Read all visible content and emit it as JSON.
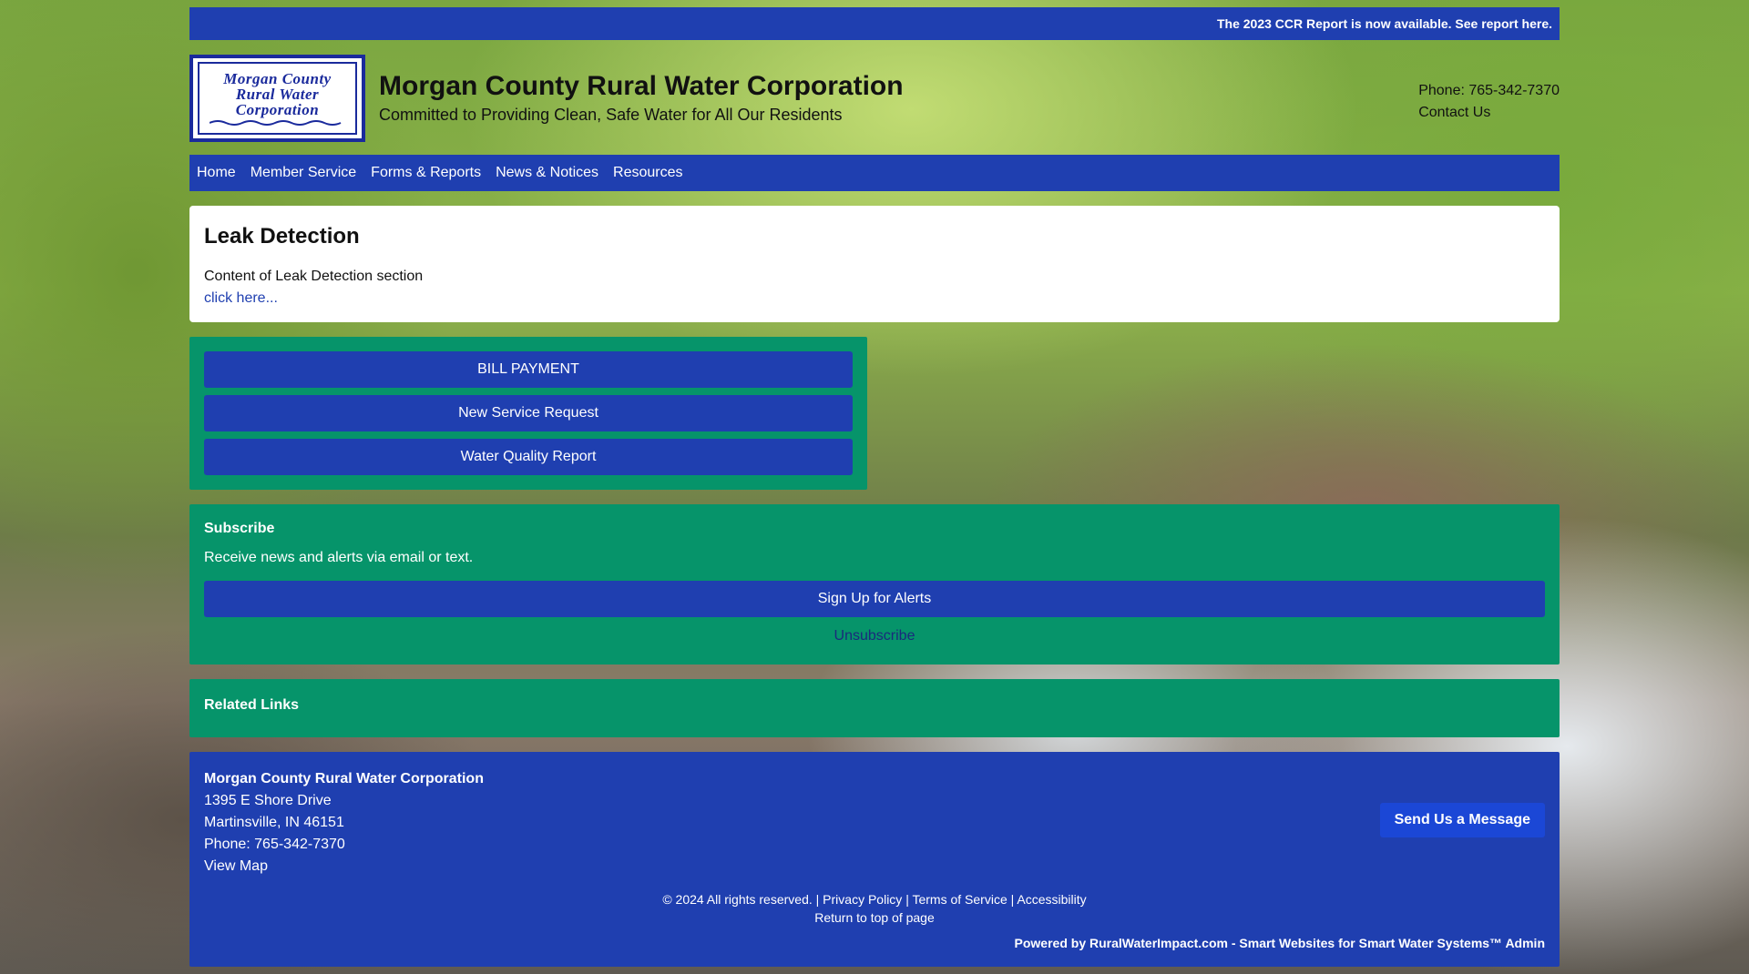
{
  "announcement": "The 2023 CCR Report is now available. See report here.",
  "logo": {
    "line1": "Morgan County",
    "line2": "Rural Water",
    "line3": "Corporation"
  },
  "header": {
    "title": "Morgan County Rural Water Corporation",
    "tagline": "Committed to Providing Clean, Safe Water for All Our Residents",
    "phone": "Phone: 765-342-7370",
    "contact": "Contact Us"
  },
  "nav": {
    "items": [
      "Home",
      "Member Service",
      "Forms & Reports",
      "News & Notices",
      "Resources"
    ]
  },
  "section": {
    "title": "Leak Detection",
    "content": "Content of Leak Detection section",
    "link": "click here..."
  },
  "quick_links": {
    "bill_payment": "BILL PAYMENT",
    "new_service": "New Service Request",
    "water_quality": "Water Quality Report"
  },
  "subscribe": {
    "title": "Subscribe",
    "text": "Receive news and alerts via email or text.",
    "signup": "Sign Up for Alerts",
    "unsubscribe": "Unsubscribe"
  },
  "related": {
    "title": "Related Links"
  },
  "footer": {
    "name": "Morgan County Rural Water Corporation",
    "street": "1395 E Shore Drive",
    "city": "Martinsville, IN 46151",
    "phone": "Phone: 765-342-7370",
    "map": "View Map",
    "send_message": "Send Us a Message",
    "copyright": "© 2024 All rights reserved.",
    "separator": "|",
    "privacy": "Privacy Policy",
    "terms": "Terms of Service",
    "accessibility": "Accessibility",
    "top": "Return to top of page",
    "powered": "Powered by RuralWaterImpact.com - Smart Websites for Smart Water Systems™",
    "admin": "Admin"
  },
  "colors": {
    "primary_blue": "#1f3fb0",
    "green": "#06946a",
    "button_blue": "#1b47d6"
  }
}
